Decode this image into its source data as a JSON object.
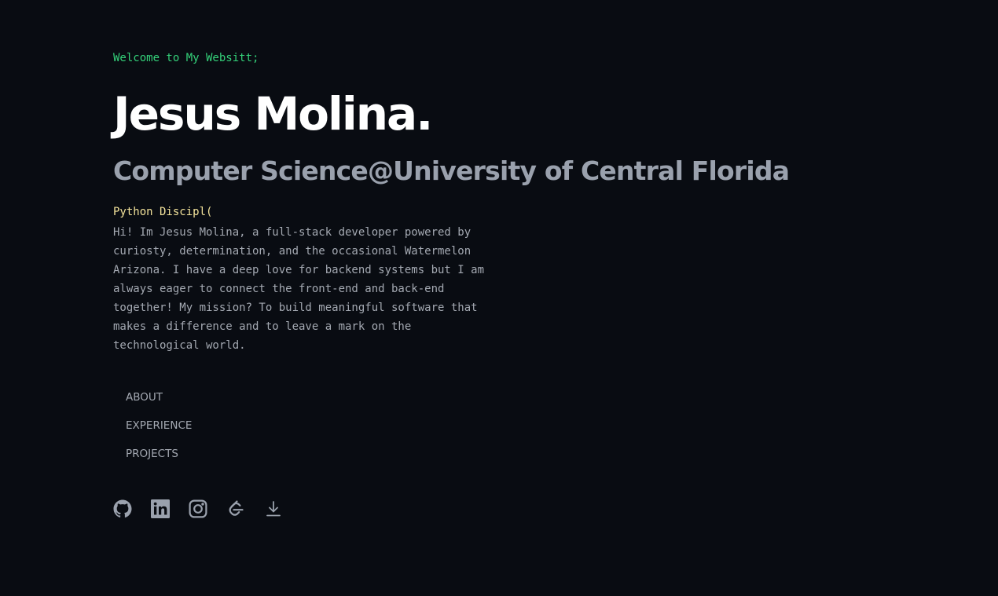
{
  "hero": {
    "welcome": "Welcome to My Websitt;",
    "name": "Jesus Molina.",
    "subtitle": "Computer Science@University of Central Florida",
    "discipline": "Python Discipl(",
    "bio_lines": [
      "Hi! Im Jesus Molina, a full-stack developer powered by",
      "curiosty, determination, and the occasional Watermelon",
      "Arizona. I have a deep love for backend systems but I am",
      "always eager to connect the front-end and back-end",
      "together! My mission? To build meaningful software that",
      "makes a difference and to leave a mark on the",
      "technological world."
    ]
  },
  "nav": {
    "items": [
      {
        "label": "ABOUT"
      },
      {
        "label": "EXPERIENCE"
      },
      {
        "label": "PROJECTS"
      }
    ]
  },
  "socials": [
    {
      "icon": "github-icon"
    },
    {
      "icon": "linkedin-icon"
    },
    {
      "icon": "instagram-icon"
    },
    {
      "icon": "leetcode-icon"
    },
    {
      "icon": "download-icon"
    }
  ],
  "colors": {
    "background": "#090c12",
    "accent_green": "#34d27a",
    "accent_yellow": "#f3e39b",
    "text_primary": "#ffffff",
    "text_muted": "#9aa1ad"
  }
}
